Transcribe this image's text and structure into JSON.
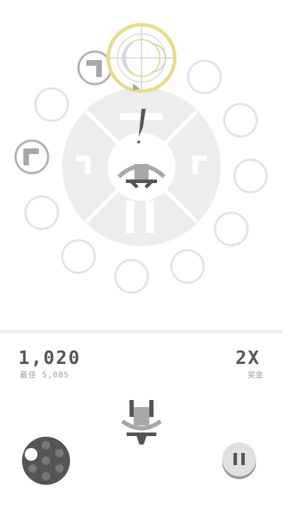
{
  "hud": {
    "score": "1,020",
    "best_label": "最佳",
    "best_value": "5,085",
    "multiplier": "2X",
    "multiplier_label": "奖金"
  },
  "colors": {
    "wheel": "#ededed",
    "ring": "#e3e3e3",
    "dark": "#555555",
    "gray": "#a8a8a8",
    "highlight": "#e6dd8a"
  },
  "icons": {
    "revolver": "revolver-cylinder-icon",
    "pause": "pause-icon"
  }
}
